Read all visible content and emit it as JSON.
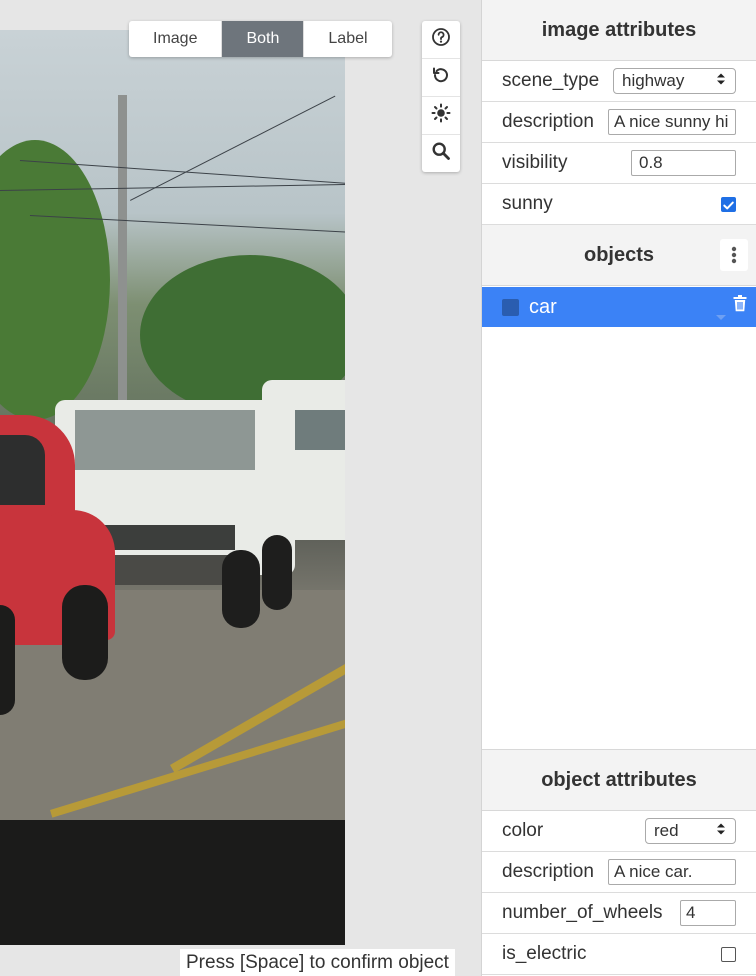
{
  "mode_toggle": {
    "image_label": "Image",
    "both_label": "Both",
    "label_label": "Label",
    "active": "Both"
  },
  "toolbar": {
    "icons": [
      "help-icon",
      "undo-icon",
      "brightness-icon",
      "zoom-icon"
    ]
  },
  "hint": {
    "text": "Press [Space] to confirm object"
  },
  "image_attributes": {
    "title": "image attributes",
    "scene_type": {
      "label": "scene_type",
      "value": "highway"
    },
    "description": {
      "label": "description",
      "value": "A nice sunny hi"
    },
    "visibility": {
      "label": "visibility",
      "value": "0.8"
    },
    "sunny": {
      "label": "sunny",
      "checked": true
    }
  },
  "objects": {
    "title": "objects",
    "items": [
      {
        "label": "car",
        "color": "#2a5db0",
        "selected": true
      }
    ]
  },
  "object_attributes": {
    "title": "object attributes",
    "color": {
      "label": "color",
      "value": "red"
    },
    "description": {
      "label": "description",
      "value": "A nice car."
    },
    "number_of_wheels": {
      "label": "number_of_wheels",
      "value": "4"
    },
    "is_electric": {
      "label": "is_electric",
      "checked": false
    }
  },
  "colors": {
    "accent": "#3b82f6",
    "checkbox_on": "#1f6fe5",
    "active_mode": "#6e757c"
  }
}
